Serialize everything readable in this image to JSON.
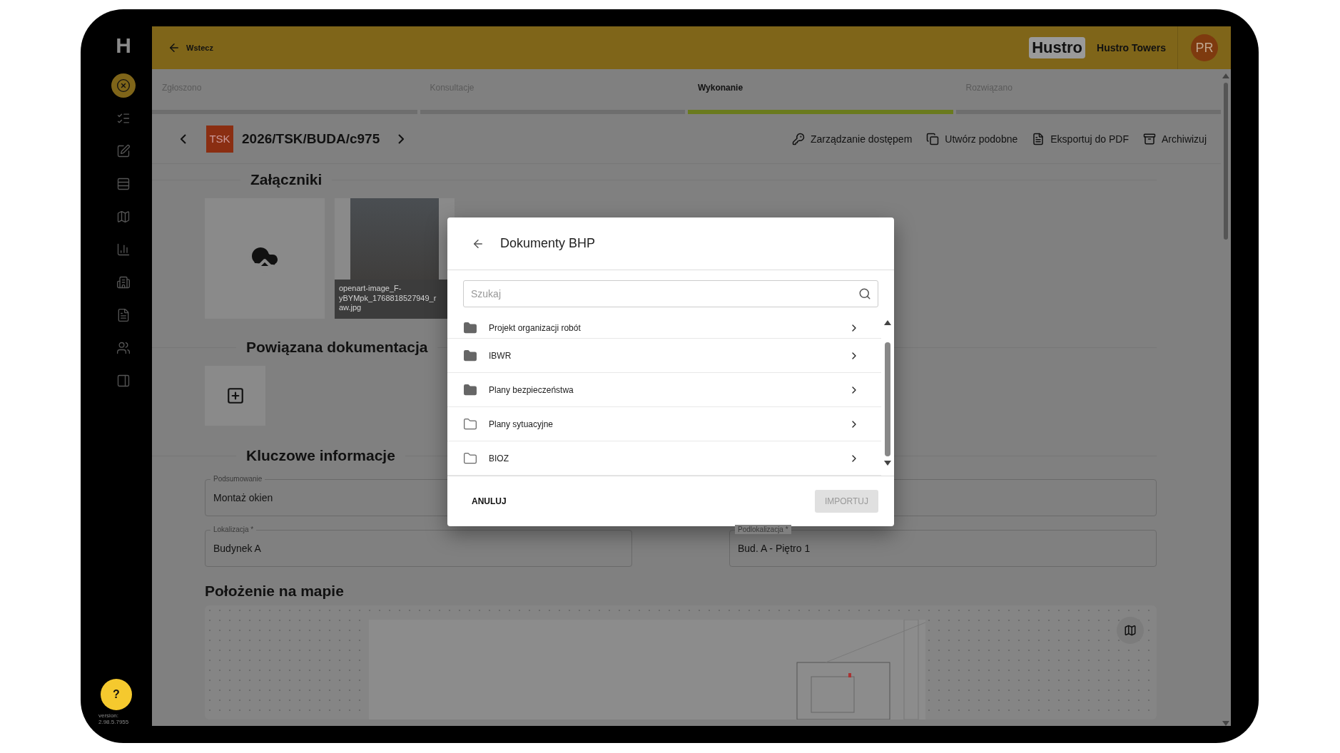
{
  "sidebar": {
    "logo": "H",
    "items": [
      {
        "selected": true
      },
      {
        "selected": false
      },
      {
        "selected": false
      },
      {
        "selected": false
      },
      {
        "selected": false
      },
      {
        "selected": false
      },
      {
        "selected": false
      },
      {
        "selected": false
      },
      {
        "selected": false
      },
      {
        "selected": false
      }
    ],
    "help": "?",
    "version": "version: 2.98.5.7955"
  },
  "header": {
    "back": "Wstecz",
    "logo": "Hustro",
    "workspace": "Hustro Towers",
    "avatar": "PR"
  },
  "stepper": [
    {
      "label": "Zgłoszono",
      "selected": false
    },
    {
      "label": "Konsultacje",
      "selected": false
    },
    {
      "label": "Wykonanie",
      "selected": true
    },
    {
      "label": "Rozwiązano",
      "selected": false
    }
  ],
  "record": {
    "badge": "TSK",
    "title": "2026/TSK/BUDA/c975",
    "actions": [
      "Zarządzanie dostępem",
      "Utwórz podobne",
      "Eksportuj do PDF",
      "Archiwizuj"
    ]
  },
  "attachments": {
    "heading": "Załączniki",
    "files": [
      {
        "name": "openart-image_F-yBYMpk_1768818527949_raw.jpg"
      }
    ]
  },
  "related": {
    "heading": "Powiązana dokumentacja"
  },
  "key_info": {
    "heading": "Kluczowe informacje",
    "fields": [
      {
        "label": "Podsumowanie",
        "value": "Montaż okien"
      },
      {
        "label": "Lokalizacja *",
        "value": "Budynek A"
      },
      {
        "label": "Podlokalizacja *",
        "value": "Bud. A - Piętro 1"
      }
    ]
  },
  "map": {
    "heading": "Położenie na mapie"
  },
  "dialog": {
    "title": "Dokumenty BHP",
    "search": {
      "placeholder": "Szukaj"
    },
    "folders": [
      {
        "name": "Projekt organizacji robót",
        "filled": true
      },
      {
        "name": "IBWR",
        "filled": true
      },
      {
        "name": "Plany bezpieczeństwa",
        "filled": true
      },
      {
        "name": "Plany sytuacyjne",
        "filled": false
      },
      {
        "name": "BIOZ",
        "filled": false
      }
    ],
    "cancel": "ANULUJ",
    "import": {
      "label": "IMPORTUJ",
      "disabled": true
    }
  }
}
